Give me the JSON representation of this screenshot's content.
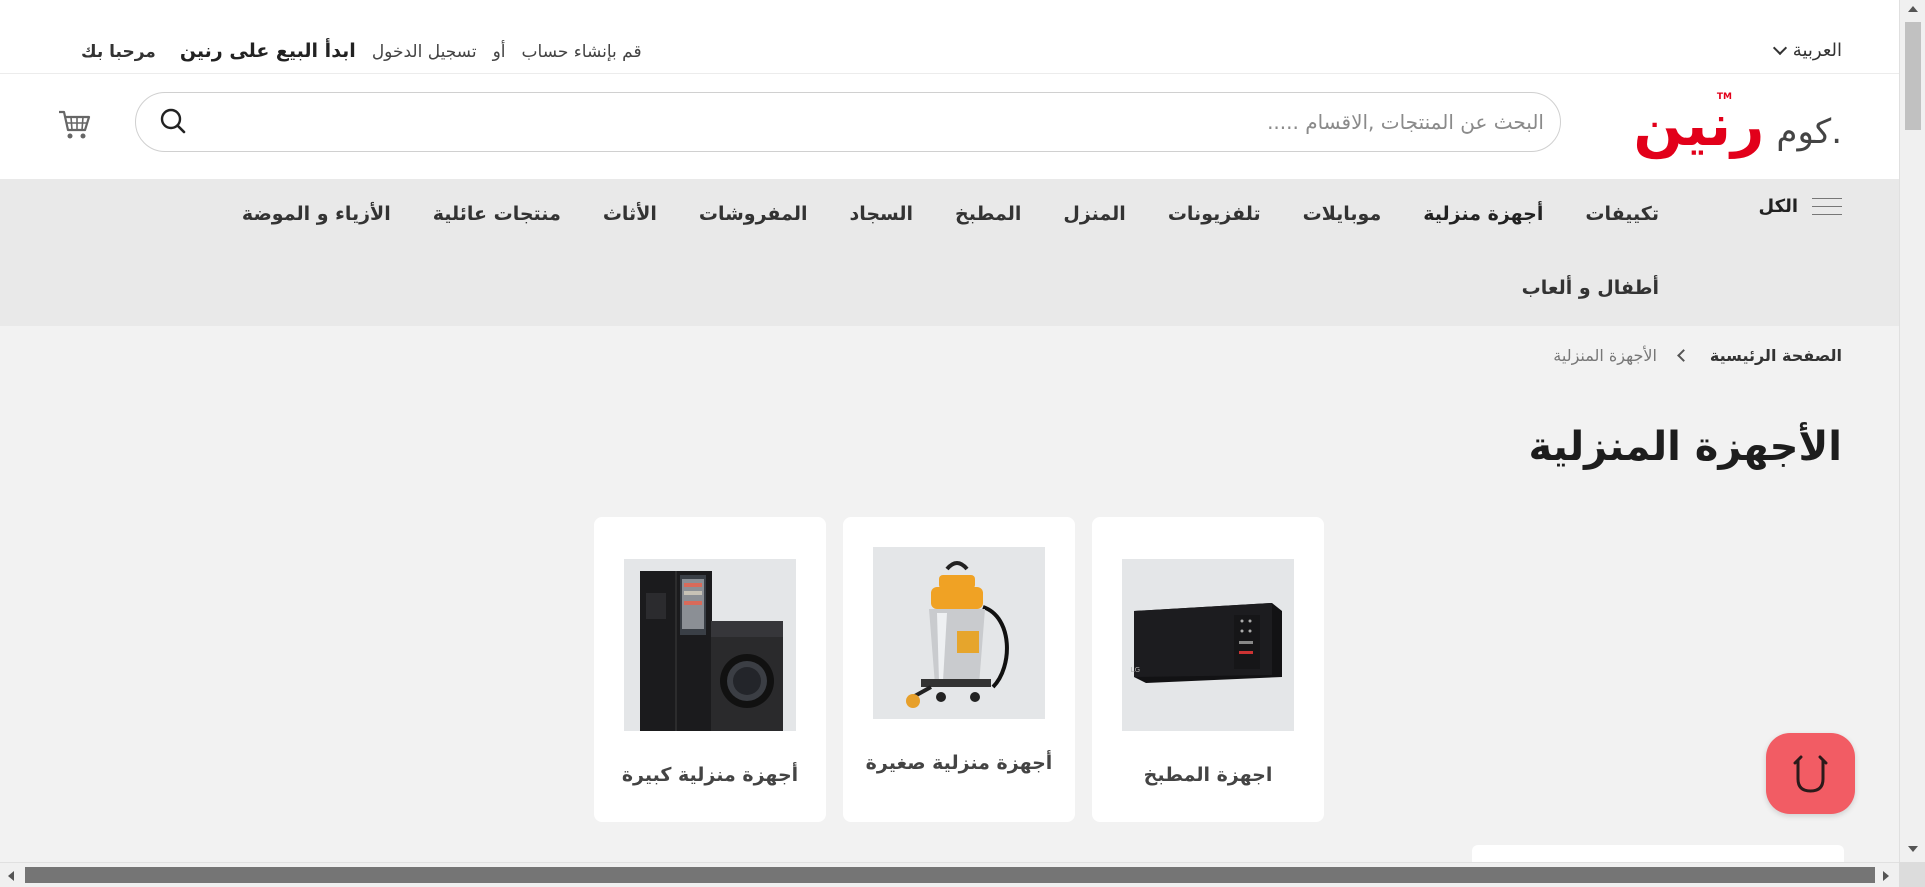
{
  "topbar": {
    "language": "العربية",
    "welcome": "مرحبا بك",
    "sell": "ابدأ البيع على رنين",
    "login": "تسجيل الدخول",
    "or": "أو",
    "register": "قم بإنشاء حساب"
  },
  "header": {
    "logo_mark": "رنين",
    "logo_suffix": ".كوم",
    "logo_tm": "TM",
    "search_placeholder": "البحث عن المنتجات ,الاقسام .....",
    "search_value": ""
  },
  "nav": {
    "all_label": "الكل",
    "row1": [
      {
        "label": "تكييفات",
        "active": false
      },
      {
        "label": "أجهزة منزلية",
        "active": true
      },
      {
        "label": "موبايلات",
        "active": false
      },
      {
        "label": "تلفزيونات",
        "active": false
      },
      {
        "label": "المنزل",
        "active": false
      },
      {
        "label": "المطبخ",
        "active": false
      },
      {
        "label": "السجاد",
        "active": false
      },
      {
        "label": "المفروشات",
        "active": false
      },
      {
        "label": "الأثاث",
        "active": false
      },
      {
        "label": "منتجات عائلية",
        "active": false
      },
      {
        "label": "الأزياء و الموضة",
        "active": false
      }
    ],
    "row2": [
      {
        "label": "أطفال و ألعاب",
        "active": false
      }
    ]
  },
  "breadcrumb": {
    "home": "الصفحة الرئيسية",
    "current": "الأجهزة المنزلية"
  },
  "page": {
    "title": "الأجهزة المنزلية"
  },
  "categories": [
    {
      "label": "أجهزة منزلية كبيرة",
      "icon": "fridge-washer-icon"
    },
    {
      "label": "أجهزة منزلية صغيرة",
      "icon": "vacuum-cleaner-icon"
    },
    {
      "label": "اجهزة المطبخ",
      "icon": "microwave-icon"
    }
  ],
  "colors": {
    "brand_red": "#e2001a",
    "chat_button": "#f25c64",
    "nav_bg": "#e9e9e9",
    "page_bg": "#f2f2f2"
  }
}
